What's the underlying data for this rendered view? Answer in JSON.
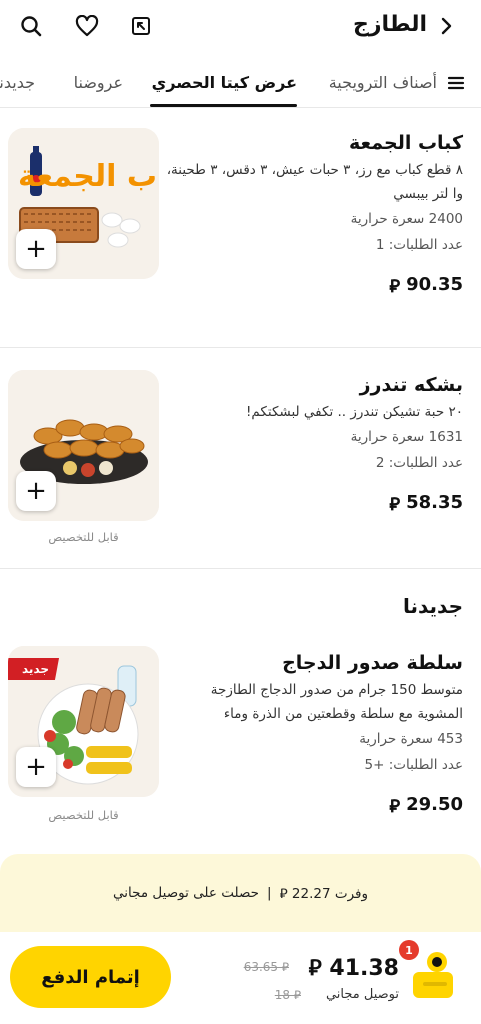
{
  "header": {
    "title": "الطازج",
    "icons": [
      "back-arrow-icon",
      "share-icon",
      "heart-icon",
      "search-icon"
    ]
  },
  "tabs": [
    {
      "label": "جديدنا",
      "active": false
    },
    {
      "label": "عروضنا",
      "active": false
    },
    {
      "label": "عرض كيتا الحصري",
      "active": true
    },
    {
      "label": "أصناف الترويجية",
      "active": false
    }
  ],
  "items": [
    {
      "name": "كباب الجمعة",
      "desc": "٨ قطع كباب مع رز، ٣ حبات عيش، ٣ دقس، ٣ طحينة، وا لتر بيبسي",
      "calories": "2400 سعرة حرارية",
      "orders": "عدد الطلبات: 1",
      "price": "90.35",
      "currency": "⃁",
      "image_text": "كباب الجمعة",
      "customizable": ""
    },
    {
      "name": "بشكه تندرز",
      "desc": "٢٠ حبة تشيكن تندرز .. تكفي لبشكتكم!",
      "calories": "1631 سعرة حرارية",
      "orders": "عدد الطلبات: 2",
      "price": "58.35",
      "currency": "⃁",
      "customizable": "قابل للتخصيص"
    },
    {
      "name": "سلطة صدور الدجاج",
      "desc": "متوسط 150 جرام من صدور الدجاج الطازجة المشوية مع سلطة وقطعتين من الذرة وماء",
      "calories": "453 سعرة حرارية",
      "orders": "عدد الطلبات: +5",
      "price": "29.50",
      "currency": "⃁",
      "badge": "جديد",
      "customizable": "قابل للتخصيص"
    }
  ],
  "section": {
    "title": "جديدنا"
  },
  "savings": {
    "saved": "وفرت 22.27 ⃁",
    "separator": "|",
    "free_delivery": "حصلت على توصيل مجاني"
  },
  "bottom": {
    "checkout": "إتمام الدفع",
    "total": "41.38 ⃁",
    "old_total": "63.65 ⃁",
    "delivery": "توصيل مجاني",
    "old_delivery": "18 ⃁",
    "cart_count": "1"
  },
  "colors": {
    "accent": "#ffd400",
    "badge_red": "#d21f24",
    "savings_bg": "#fdf8d9"
  }
}
